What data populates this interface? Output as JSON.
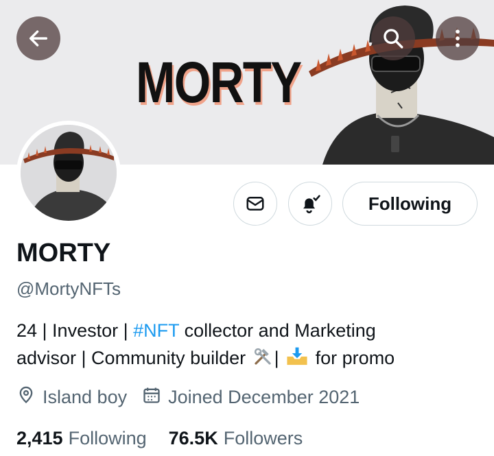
{
  "banner": {
    "title": "MORTY"
  },
  "profile": {
    "name": "MORTY",
    "handle": "@MortyNFTs",
    "follow_state": "Following",
    "bio": {
      "part1": "24 | Investor | ",
      "hashtag": "#NFT",
      "part2": " collector and Marketing",
      "part3": "advisor | Community builder ",
      "part4": "| ",
      "part5": " for promo"
    },
    "location": "Island boy",
    "joined": "Joined December 2021"
  },
  "stats": {
    "following_count": "2,415",
    "following_label": "Following",
    "followers_count": "76.5K",
    "followers_label": "Followers"
  },
  "icons": {
    "back": "arrow-left-icon",
    "search": "search-icon",
    "more": "more-vertical-icon",
    "message": "envelope-icon",
    "notifications": "bell-check-icon",
    "location": "location-pin-icon",
    "calendar": "calendar-icon"
  },
  "colors": {
    "link": "#1d9bf0",
    "secondary_text": "#536471",
    "primary_text": "#0f1419"
  }
}
